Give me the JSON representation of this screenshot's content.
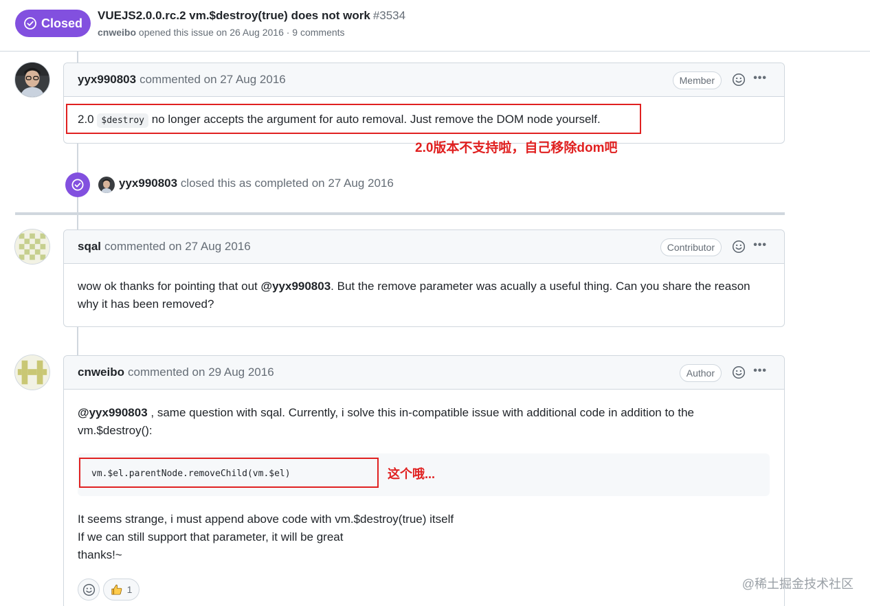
{
  "issue": {
    "status": "Closed",
    "title": "VUEJS2.0.0.rc.2 vm.$destroy(true) does not work",
    "number": "#3534",
    "author": "cnweibo",
    "opened_text": "opened this issue on 26 Aug 2016 · 9 comments",
    "status_color": "#8250df"
  },
  "comments": [
    {
      "author": "yyx990803",
      "meta": "commented on 27 Aug 2016",
      "role": "Member",
      "body": {
        "prefix": "2.0",
        "code": "$destroy",
        "suffix": "no longer accepts the argument for auto removal. Just remove the DOM node yourself."
      },
      "annotation": "2.0版本不支持啦，自己移除dom吧"
    },
    {
      "author": "sqal",
      "meta": "commented on 27 Aug 2016",
      "role": "Contributor",
      "body": {
        "before": "wow ok thanks for pointing that out",
        "mention": "@yyx990803",
        "after": ". But the remove parameter was acually a useful thing. Can you share the reason",
        "line2": "why it has been removed?"
      }
    },
    {
      "author": "cnweibo",
      "meta": "commented on 29 Aug 2016",
      "role": "Author",
      "body": {
        "mention": "@yyx990803",
        "line1_rest": " , same question with sqal. Currently, i solve this in-compatible issue with additional code in addition to the",
        "line2": "vm.$destroy():",
        "code": "vm.$el.parentNode.removeChild(vm.$el)",
        "annotation": "这个哦...",
        "line3": "It seems strange, i must append above code with vm.$destroy(true) itself",
        "line4": "If we can still support that parameter, it will be great",
        "line5": "thanks!~"
      },
      "reactions": {
        "thumbs_up_count": "1"
      }
    }
  ],
  "event": {
    "actor": "yyx990803",
    "text": "closed this as completed on 27 Aug 2016"
  },
  "watermark": "@稀土掘金技术社区",
  "icons": {
    "status": "check-circle-icon",
    "emoji": "smiley-icon",
    "more": "kebab-horizontal-icon",
    "thumbs_up": "thumbs-up-icon"
  },
  "colors": {
    "annotation_red": "#e02020",
    "purple": "#8250df"
  }
}
